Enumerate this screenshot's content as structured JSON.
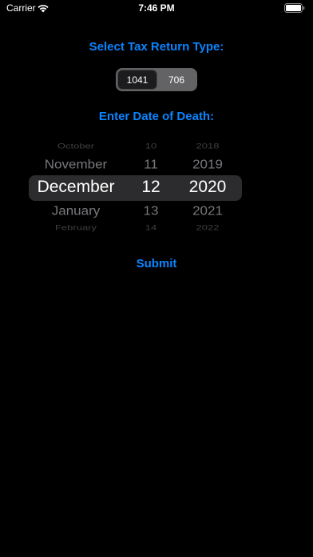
{
  "status_bar": {
    "carrier": "Carrier",
    "time": "7:46 PM",
    "wifi_icon": "wifi-icon",
    "battery_icon": "battery-icon"
  },
  "tax_section": {
    "heading": "Select Tax Return Type:",
    "options": [
      "1041",
      "706"
    ],
    "selected": "1041"
  },
  "death_section": {
    "heading": "Enter Date of Death:"
  },
  "picker": {
    "months": [
      "October",
      "November",
      "December",
      "January",
      "February"
    ],
    "days": [
      "10",
      "11",
      "12",
      "13",
      "14"
    ],
    "years": [
      "2018",
      "2019",
      "2020",
      "2021",
      "2022"
    ],
    "selected": {
      "month": "December",
      "day": "12",
      "year": "2020"
    }
  },
  "submit_label": "Submit",
  "colors": {
    "accent": "#0a84ff",
    "background": "#000000",
    "segment_bg": "#636366",
    "picker_highlight": "#2c2c2e"
  }
}
